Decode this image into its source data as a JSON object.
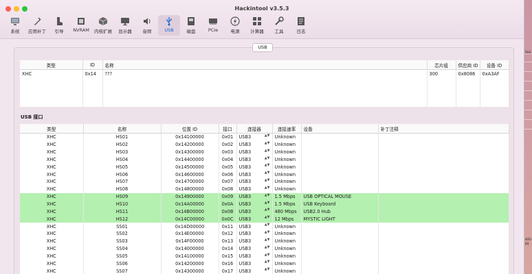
{
  "window": {
    "title": "Hackintool v3.5.3"
  },
  "toolbar": [
    {
      "label": "系统",
      "icon": "computer-icon"
    },
    {
      "label": "应用补丁",
      "icon": "patch-icon"
    },
    {
      "label": "引导",
      "icon": "boot-icon"
    },
    {
      "label": "NVRAM",
      "icon": "nvram-icon"
    },
    {
      "label": "内核扩展",
      "icon": "kext-icon"
    },
    {
      "label": "显示器",
      "icon": "display-icon"
    },
    {
      "label": "音频",
      "icon": "audio-icon"
    },
    {
      "label": "USB",
      "icon": "usb-icon",
      "active": true
    },
    {
      "label": "磁盘",
      "icon": "disk-icon"
    },
    {
      "label": "PCIe",
      "icon": "pcie-icon"
    },
    {
      "label": "电源",
      "icon": "power-icon"
    },
    {
      "label": "计算器",
      "icon": "calculator-icon"
    },
    {
      "label": "工具",
      "icon": "tools-icon"
    },
    {
      "label": "日志",
      "icon": "log-icon"
    }
  ],
  "usb_pill": "USB",
  "controllers": {
    "headers": [
      "类型",
      "ID",
      "名称",
      "芯片组",
      "供应商 ID",
      "设备 ID"
    ],
    "rows": [
      [
        "XHC",
        "0x14",
        "???",
        "300",
        "0x8086",
        "0xA3AF"
      ]
    ]
  },
  "ports": {
    "section_title": "USB 接口",
    "headers": [
      "类型",
      "名称",
      "位置 ID",
      "接口",
      "连接器",
      "连接速率",
      "设备",
      "补丁注释"
    ],
    "rows": [
      [
        "XHC",
        "HS01",
        "0x14100000",
        "0x01",
        "USB3",
        "Unknown",
        "",
        ""
      ],
      [
        "XHC",
        "HS02",
        "0x14200000",
        "0x02",
        "USB3",
        "Unknown",
        "",
        ""
      ],
      [
        "XHC",
        "HS03",
        "0x14300000",
        "0x03",
        "USB3",
        "Unknown",
        "",
        ""
      ],
      [
        "XHC",
        "HS04",
        "0x14400000",
        "0x04",
        "USB3",
        "Unknown",
        "",
        ""
      ],
      [
        "XHC",
        "HS05",
        "0x14500000",
        "0x05",
        "USB3",
        "Unknown",
        "",
        ""
      ],
      [
        "XHC",
        "HS06",
        "0x14600000",
        "0x06",
        "USB3",
        "Unknown",
        "",
        ""
      ],
      [
        "XHC",
        "HS07",
        "0x14700000",
        "0x07",
        "USB3",
        "Unknown",
        "",
        ""
      ],
      [
        "XHC",
        "HS08",
        "0x14800000",
        "0x08",
        "USB3",
        "Unknown",
        "",
        ""
      ],
      [
        "XHC",
        "HS09",
        "0x14900000",
        "0x09",
        "USB3",
        "1.5 Mbps",
        "USB OPTICAL MOUSE",
        ""
      ],
      [
        "XHC",
        "HS10",
        "0x14A00000",
        "0x0A",
        "USB3",
        "1.5 Mbps",
        "USB Keyboard",
        ""
      ],
      [
        "XHC",
        "HS11",
        "0x14B00000",
        "0x0B",
        "USB3",
        "480 Mbps",
        "USB2.0 Hub",
        ""
      ],
      [
        "XHC",
        "HS12",
        "0x14C00000",
        "0x0C",
        "USB3",
        "12 Mbps",
        "MYSTIC LIGHT",
        ""
      ],
      [
        "XHC",
        "SS01",
        "0x14D00000",
        "0x11",
        "USB3",
        "Unknown",
        "",
        ""
      ],
      [
        "XHC",
        "SS02",
        "0x14E00000",
        "0x12",
        "USB3",
        "Unknown",
        "",
        ""
      ],
      [
        "XHC",
        "SS03",
        "0x14F00000",
        "0x13",
        "USB3",
        "Unknown",
        "",
        ""
      ],
      [
        "XHC",
        "SS04",
        "0x14000000",
        "0x14",
        "USB3",
        "Unknown",
        "",
        ""
      ],
      [
        "XHC",
        "SS05",
        "0x14100000",
        "0x15",
        "USB3",
        "Unknown",
        "",
        ""
      ],
      [
        "XHC",
        "SS06",
        "0x14200000",
        "0x16",
        "USB3",
        "Unknown",
        "",
        ""
      ],
      [
        "XHC",
        "SS07",
        "0x14300000",
        "0x17",
        "USB3",
        "Unknown",
        "",
        ""
      ]
    ],
    "connected_rows": [
      8,
      9,
      10,
      11
    ]
  },
  "right_edge": {
    "text1": "los",
    "text2": "elo M"
  },
  "colors": {
    "accent": "#1663d6",
    "connected": "#b4f0b0"
  }
}
